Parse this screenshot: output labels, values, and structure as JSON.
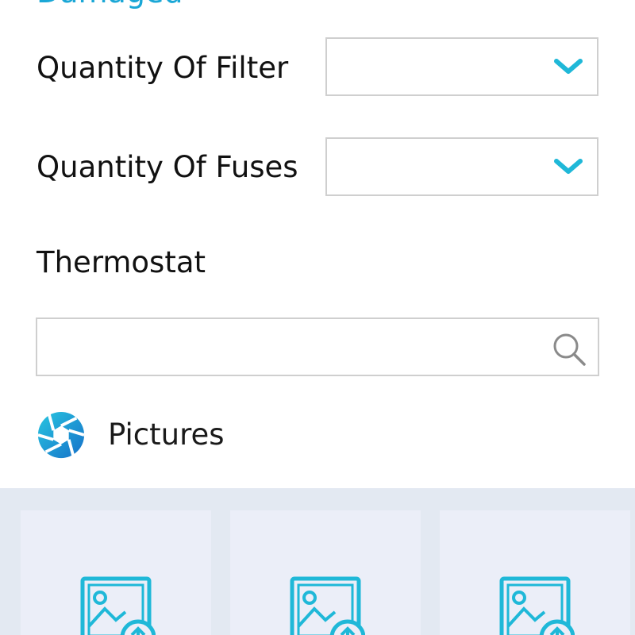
{
  "form": {
    "heading_partial": "Damaged",
    "fields": [
      {
        "label": "Quantity Of Filter",
        "value": ""
      },
      {
        "label": "Quantity Of Fuses",
        "value": ""
      }
    ],
    "thermostat": {
      "label": "Thermostat",
      "value": ""
    }
  },
  "pictures": {
    "title": "Pictures",
    "tiles": [
      "upload-slot-1",
      "upload-slot-2",
      "upload-slot-3"
    ]
  },
  "colors": {
    "accent": "#1fb8d8",
    "border": "#cfcfcf",
    "gallery_bg": "#e3e9f2",
    "tile_bg": "#ebeef8"
  },
  "icons": {
    "dropdown": "chevron-down-icon",
    "search": "search-icon",
    "section": "camera-shutter-icon",
    "upload": "image-upload-icon"
  }
}
